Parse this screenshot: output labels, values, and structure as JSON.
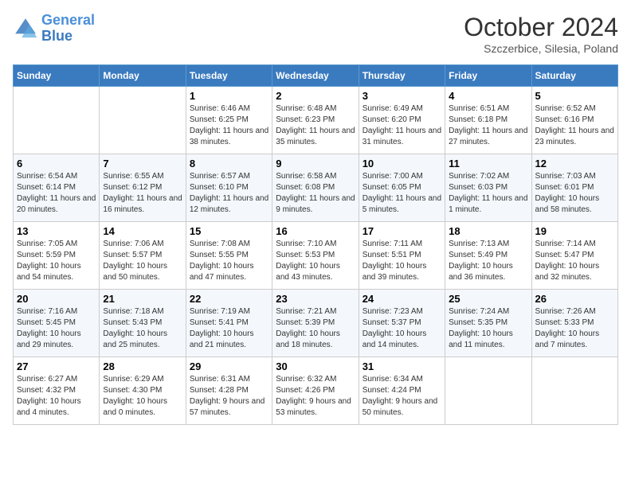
{
  "header": {
    "logo_line1": "General",
    "logo_line2": "Blue",
    "month_title": "October 2024",
    "location": "Szczerbice, Silesia, Poland"
  },
  "days_of_week": [
    "Sunday",
    "Monday",
    "Tuesday",
    "Wednesday",
    "Thursday",
    "Friday",
    "Saturday"
  ],
  "weeks": [
    [
      {
        "num": "",
        "info": ""
      },
      {
        "num": "",
        "info": ""
      },
      {
        "num": "1",
        "info": "Sunrise: 6:46 AM\nSunset: 6:25 PM\nDaylight: 11 hours and 38 minutes."
      },
      {
        "num": "2",
        "info": "Sunrise: 6:48 AM\nSunset: 6:23 PM\nDaylight: 11 hours and 35 minutes."
      },
      {
        "num": "3",
        "info": "Sunrise: 6:49 AM\nSunset: 6:20 PM\nDaylight: 11 hours and 31 minutes."
      },
      {
        "num": "4",
        "info": "Sunrise: 6:51 AM\nSunset: 6:18 PM\nDaylight: 11 hours and 27 minutes."
      },
      {
        "num": "5",
        "info": "Sunrise: 6:52 AM\nSunset: 6:16 PM\nDaylight: 11 hours and 23 minutes."
      }
    ],
    [
      {
        "num": "6",
        "info": "Sunrise: 6:54 AM\nSunset: 6:14 PM\nDaylight: 11 hours and 20 minutes."
      },
      {
        "num": "7",
        "info": "Sunrise: 6:55 AM\nSunset: 6:12 PM\nDaylight: 11 hours and 16 minutes."
      },
      {
        "num": "8",
        "info": "Sunrise: 6:57 AM\nSunset: 6:10 PM\nDaylight: 11 hours and 12 minutes."
      },
      {
        "num": "9",
        "info": "Sunrise: 6:58 AM\nSunset: 6:08 PM\nDaylight: 11 hours and 9 minutes."
      },
      {
        "num": "10",
        "info": "Sunrise: 7:00 AM\nSunset: 6:05 PM\nDaylight: 11 hours and 5 minutes."
      },
      {
        "num": "11",
        "info": "Sunrise: 7:02 AM\nSunset: 6:03 PM\nDaylight: 11 hours and 1 minute."
      },
      {
        "num": "12",
        "info": "Sunrise: 7:03 AM\nSunset: 6:01 PM\nDaylight: 10 hours and 58 minutes."
      }
    ],
    [
      {
        "num": "13",
        "info": "Sunrise: 7:05 AM\nSunset: 5:59 PM\nDaylight: 10 hours and 54 minutes."
      },
      {
        "num": "14",
        "info": "Sunrise: 7:06 AM\nSunset: 5:57 PM\nDaylight: 10 hours and 50 minutes."
      },
      {
        "num": "15",
        "info": "Sunrise: 7:08 AM\nSunset: 5:55 PM\nDaylight: 10 hours and 47 minutes."
      },
      {
        "num": "16",
        "info": "Sunrise: 7:10 AM\nSunset: 5:53 PM\nDaylight: 10 hours and 43 minutes."
      },
      {
        "num": "17",
        "info": "Sunrise: 7:11 AM\nSunset: 5:51 PM\nDaylight: 10 hours and 39 minutes."
      },
      {
        "num": "18",
        "info": "Sunrise: 7:13 AM\nSunset: 5:49 PM\nDaylight: 10 hours and 36 minutes."
      },
      {
        "num": "19",
        "info": "Sunrise: 7:14 AM\nSunset: 5:47 PM\nDaylight: 10 hours and 32 minutes."
      }
    ],
    [
      {
        "num": "20",
        "info": "Sunrise: 7:16 AM\nSunset: 5:45 PM\nDaylight: 10 hours and 29 minutes."
      },
      {
        "num": "21",
        "info": "Sunrise: 7:18 AM\nSunset: 5:43 PM\nDaylight: 10 hours and 25 minutes."
      },
      {
        "num": "22",
        "info": "Sunrise: 7:19 AM\nSunset: 5:41 PM\nDaylight: 10 hours and 21 minutes."
      },
      {
        "num": "23",
        "info": "Sunrise: 7:21 AM\nSunset: 5:39 PM\nDaylight: 10 hours and 18 minutes."
      },
      {
        "num": "24",
        "info": "Sunrise: 7:23 AM\nSunset: 5:37 PM\nDaylight: 10 hours and 14 minutes."
      },
      {
        "num": "25",
        "info": "Sunrise: 7:24 AM\nSunset: 5:35 PM\nDaylight: 10 hours and 11 minutes."
      },
      {
        "num": "26",
        "info": "Sunrise: 7:26 AM\nSunset: 5:33 PM\nDaylight: 10 hours and 7 minutes."
      }
    ],
    [
      {
        "num": "27",
        "info": "Sunrise: 6:27 AM\nSunset: 4:32 PM\nDaylight: 10 hours and 4 minutes."
      },
      {
        "num": "28",
        "info": "Sunrise: 6:29 AM\nSunset: 4:30 PM\nDaylight: 10 hours and 0 minutes."
      },
      {
        "num": "29",
        "info": "Sunrise: 6:31 AM\nSunset: 4:28 PM\nDaylight: 9 hours and 57 minutes."
      },
      {
        "num": "30",
        "info": "Sunrise: 6:32 AM\nSunset: 4:26 PM\nDaylight: 9 hours and 53 minutes."
      },
      {
        "num": "31",
        "info": "Sunrise: 6:34 AM\nSunset: 4:24 PM\nDaylight: 9 hours and 50 minutes."
      },
      {
        "num": "",
        "info": ""
      },
      {
        "num": "",
        "info": ""
      }
    ]
  ]
}
